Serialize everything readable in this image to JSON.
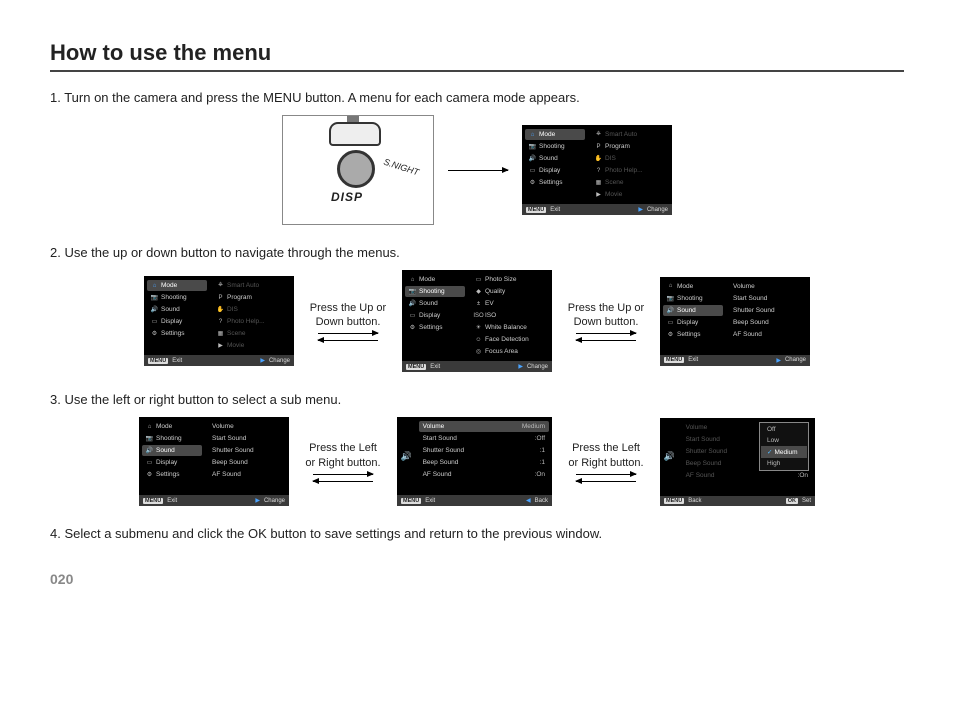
{
  "title": "How to use the menu",
  "page_number": "020",
  "steps": {
    "s1": "1. Turn on the camera and press the MENU button. A menu for each camera mode appears.",
    "s2": "2. Use the up or down button to navigate through the menus.",
    "s3": "3. Use the left or right button to select a sub menu.",
    "s4": "4. Select a submenu and click the OK button to save settings and return to the previous window."
  },
  "captions": {
    "updown": "Press the Up or Down button.",
    "leftright": "Press the Left or Right button."
  },
  "camera": {
    "disp": "DISP",
    "snight": "S.NIGHT"
  },
  "footer": {
    "menu": "MENU",
    "exit": "Exit",
    "change": "Change",
    "back": "Back",
    "ok": "OK",
    "set": "Set"
  },
  "main_tabs": {
    "mode": "Mode",
    "shooting": "Shooting",
    "sound": "Sound",
    "display": "Display",
    "settings": "Settings"
  },
  "mode_opts": {
    "smart": "Smart Auto",
    "program": "Program",
    "dis": "DIS",
    "photohelp": "Photo Help...",
    "scene": "Scene",
    "movie": "Movie"
  },
  "shoot_opts": {
    "photosize": "Photo Size",
    "quality": "Quality",
    "ev": "EV",
    "iso": "ISO",
    "wb": "White Balance",
    "face": "Face Detection",
    "focus": "Focus Area"
  },
  "sound_opts": {
    "volume": "Volume",
    "start": "Start Sound",
    "shutter": "Shutter Sound",
    "beep": "Beep Sound",
    "af": "AF Sound"
  },
  "sound_vals": {
    "volume": "Medium",
    "start": ":Off",
    "shutter": ":1",
    "beep": ":1",
    "af": ":On"
  },
  "vol_popup": {
    "off": "Off",
    "low": "Low",
    "medium": "Medium",
    "high": "High"
  }
}
